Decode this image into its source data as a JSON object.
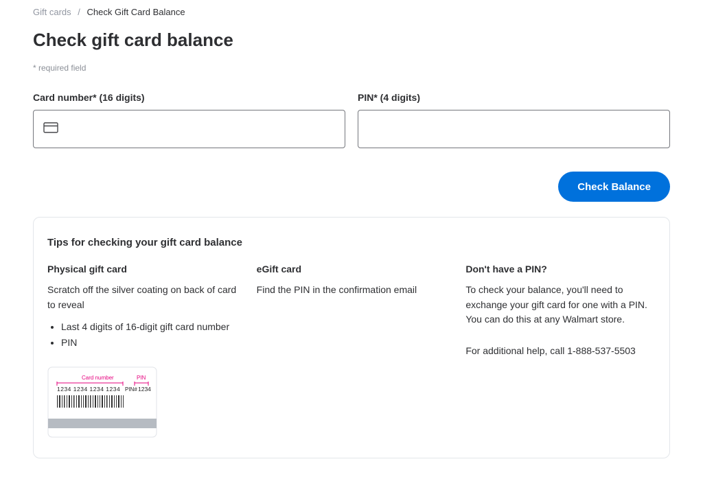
{
  "breadcrumb": {
    "link": "Gift cards",
    "current": "Check Gift Card Balance"
  },
  "page_title": "Check gift card balance",
  "required_note": "* required field",
  "form": {
    "card_label": "Card number* (16 digits)",
    "pin_label": "PIN* (4 digits)",
    "card_value": "",
    "pin_value": ""
  },
  "button": {
    "check_balance": "Check Balance"
  },
  "tips": {
    "title": "Tips for checking your gift card balance",
    "physical": {
      "heading": "Physical gift card",
      "intro": "Scratch off the silver coating on back of card to reveal",
      "bullet1": "Last 4 digits of 16-digit gift card number",
      "bullet2": "PIN"
    },
    "egift": {
      "heading": "eGift card",
      "body": "Find the PIN in the confirmation email"
    },
    "nopin": {
      "heading": "Don't have a PIN?",
      "body": "To check your balance, you'll need to exchange your gift card for one with a PIN. You can do this at any Walmart store.",
      "help": "For additional help, call 1-888-537-5503"
    }
  },
  "card_image": {
    "label_card": "Card number",
    "label_pin": "PIN",
    "digits": "1234 1234 1234 1234",
    "pin_prefix": "PIN#",
    "pin_digits": "1234"
  }
}
